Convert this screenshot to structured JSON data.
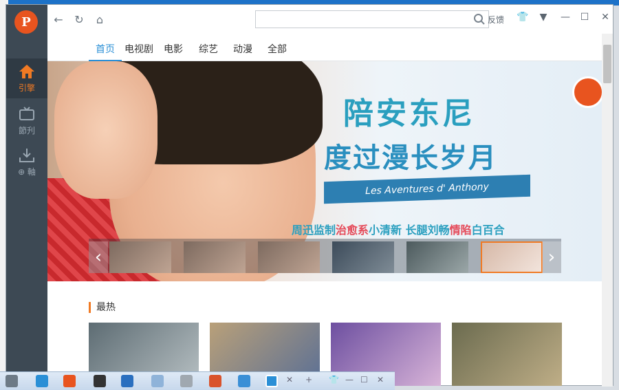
{
  "app": {
    "title": "PPTV"
  },
  "sidebar": {
    "items": [
      {
        "label": "引擎",
        "icon": "home-icon"
      },
      {
        "label": "節刋",
        "icon": "tv-icon"
      },
      {
        "label": "⊕ 軸",
        "icon": "download-icon"
      }
    ]
  },
  "toolbar": {
    "search_placeholder": "",
    "feedback_label": "反馈"
  },
  "tabs": [
    "首页",
    "电视剧",
    "电影",
    "综艺",
    "动漫",
    "全部"
  ],
  "banner": {
    "title_line1": "陪安东尼",
    "title_line2": "度过漫长岁月",
    "ribbon_text": "Les Aventures d' Anthony",
    "subtitle_parts": [
      "周迅监制",
      "治愈系",
      "小清新 长腿刘畅",
      "情陷",
      "白百合"
    ]
  },
  "section": {
    "title": "最热"
  },
  "colors": {
    "accent": "#f07a24",
    "link": "#2a8fd6",
    "sidebar": "#3d4954"
  }
}
